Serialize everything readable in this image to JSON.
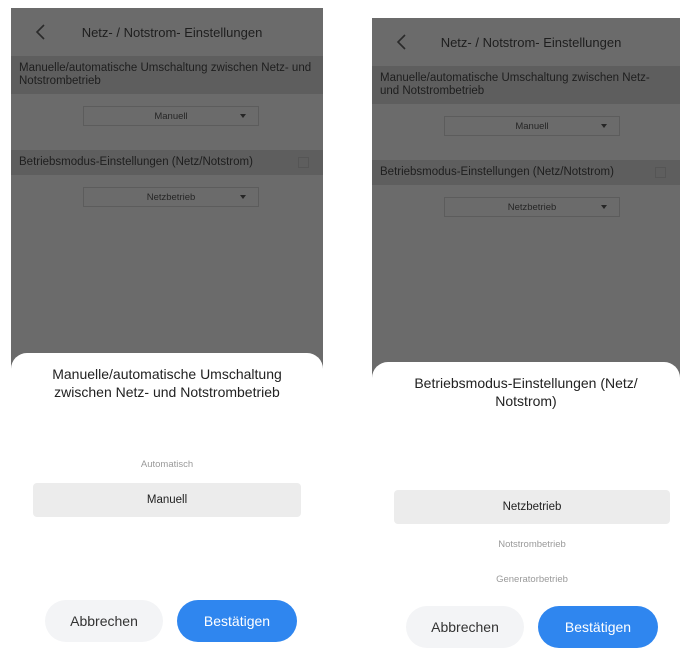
{
  "screens": [
    {
      "header_title": "Netz- / Notstrom- Einstellungen",
      "switch_label": "Manuelle/automatische Umschaltung zwischen Netz- und Notstrombetrieb",
      "switch_value": "Manuell",
      "mode_label": "Betriebsmodus-Einstellungen (Netz/Notstrom)",
      "mode_value": "Netzbetrieb",
      "sheet": {
        "title": "Manuelle/automatische Umschaltung zwischen Netz- und Notstrombetrieb",
        "options": [
          "Automatisch",
          "Manuell"
        ],
        "selected": "Manuell",
        "cancel_label": "Abbrechen",
        "confirm_label": "Bestätigen"
      }
    },
    {
      "header_title": "Netz- / Notstrom- Einstellungen",
      "switch_label": "Manuelle/automatische Umschaltung zwischen Netz- und Notstrombetrieb",
      "switch_value": "Manuell",
      "mode_label": "Betriebsmodus-Einstellungen (Netz/Notstrom)",
      "mode_value": "Netzbetrieb",
      "sheet": {
        "title": "Betriebsmodus-Einstellungen (Netz/ Notstrom)",
        "options": [
          "Netzbetrieb",
          "Notstrombetrieb",
          "Generatorbetrieb"
        ],
        "selected": "Netzbetrieb",
        "cancel_label": "Abbrechen",
        "confirm_label": "Bestätigen"
      }
    }
  ],
  "colors": {
    "accent": "#2f86ef",
    "overlay": "#6b6b6b"
  }
}
